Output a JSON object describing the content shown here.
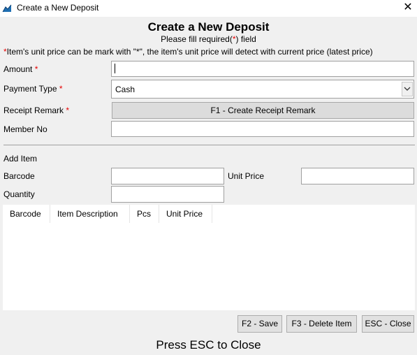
{
  "window": {
    "title": "Create a New Deposit",
    "close_glyph": "✕"
  },
  "header": {
    "title": "Create a New Deposit",
    "subtitle_pre": "Please fill required(",
    "subtitle_star": "*",
    "subtitle_post": ") field"
  },
  "note": {
    "star": "*",
    "text": "Item's unit price can be mark with \"*\", the item's unit price will detect with current price (latest price)"
  },
  "form": {
    "amount": {
      "label": "Amount",
      "star": "*",
      "value": ""
    },
    "payment_type": {
      "label": "Payment Type",
      "star": "*",
      "value": "Cash"
    },
    "receipt_remark": {
      "label": "Receipt Remark",
      "star": "*",
      "button": "F1 - Create Receipt Remark"
    },
    "member_no": {
      "label": "Member No",
      "value": ""
    }
  },
  "add_item": {
    "title": "Add Item",
    "barcode_label": "Barcode",
    "unit_price_label": "Unit Price",
    "quantity_label": "Quantity"
  },
  "grid": {
    "columns": [
      "Barcode",
      "Item Description",
      "Pcs",
      "Unit Price"
    ]
  },
  "buttons": {
    "save": "F2 - Save",
    "delete": "F3 - Delete Item",
    "close": "ESC - Close"
  },
  "footer": "Press ESC to Close",
  "colors": {
    "required": "#e60000",
    "background": "#f0f0f0"
  },
  "icons": {
    "app": "app-chart-icon",
    "close": "close-icon",
    "dropdown": "chevron-down-icon"
  }
}
